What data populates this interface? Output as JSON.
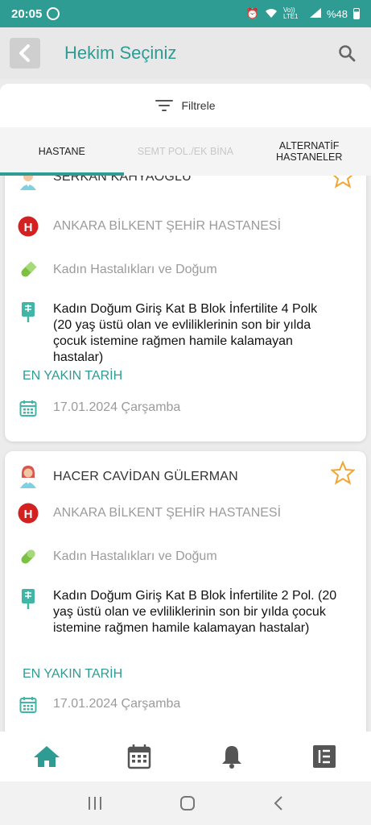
{
  "status_bar": {
    "time": "20:05",
    "battery": "%48",
    "network": "Vo)) LTE1"
  },
  "header": {
    "title": "Hekim Seçiniz"
  },
  "filter": {
    "label": "Filtrele"
  },
  "tabs": [
    {
      "label": "HASTANE",
      "active": true
    },
    {
      "label": "SEMT POL./EK BİNA",
      "active": false
    },
    {
      "label": "ALTERNATİF HASTANELER",
      "active": false
    }
  ],
  "doctors": [
    {
      "name": "SERKAN KAHYAOĞLU",
      "hospital": "ANKARA BİLKENT ŞEHİR HASTANESİ",
      "department": "Kadın Hastalıkları ve Doğum",
      "clinic": "Kadın Doğum Giriş Kat  B Blok İnfertilite 4 Polk  (20 yaş üstü olan ve evliliklerinin son bir yılda çocuk istemine rağmen hamile kalamayan hastalar)",
      "nearest_label": "EN YAKIN TARİH",
      "date": "17.01.2024 Çarşamba"
    },
    {
      "name": "HACER CAVİDAN GÜLERMAN",
      "hospital": "ANKARA BİLKENT ŞEHİR HASTANESİ",
      "department": "Kadın Hastalıkları ve Doğum",
      "clinic": "Kadın Doğum Giriş Kat  B Blok İnfertilite 2 Pol. (20 yaş üstü olan ve evliliklerinin son bir yılda çocuk istemine rağmen hamile kalamayan hastalar)",
      "nearest_label": "EN YAKIN TARİH",
      "date": "17.01.2024 Çarşamba"
    }
  ],
  "bottom_nav": [
    {
      "icon": "home-icon",
      "active": true
    },
    {
      "icon": "calendar-icon",
      "active": false
    },
    {
      "icon": "bell-icon",
      "active": false
    },
    {
      "icon": "list-icon",
      "active": false
    }
  ],
  "colors": {
    "accent": "#2f9c94",
    "star": "#f2a531",
    "hospital_red": "#d32020",
    "pill_green": "#7cc142"
  }
}
